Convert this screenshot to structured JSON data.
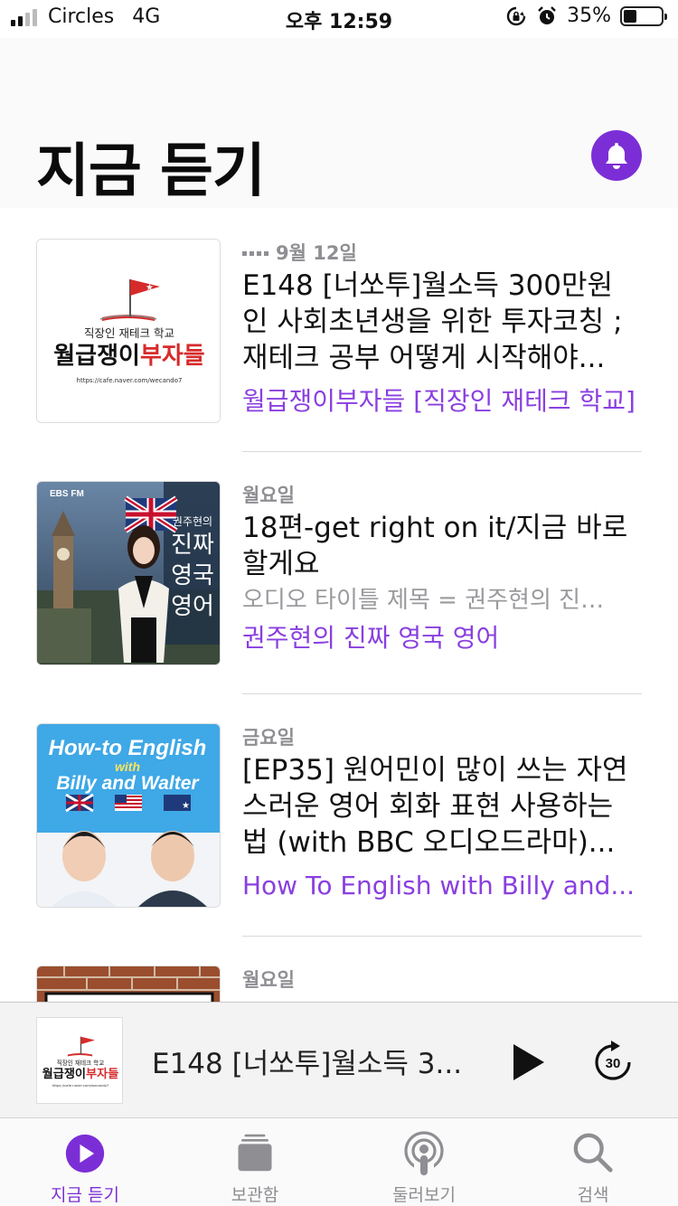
{
  "status_bar": {
    "carrier": "Circles",
    "network": "4G",
    "time": "오후 12:59",
    "battery": "35%"
  },
  "header": {
    "title": "지금 듣기"
  },
  "episodes": [
    {
      "date": "9월 12일",
      "title": "E148 [너쏘투]월소득 300만원 인 사회초년생을 위한 투자코칭 ; 재테크 공부 어떻게 시작해야...",
      "description": "",
      "show": "월급쟁이부자들 [직장인 재테크 학교]",
      "art": {
        "subtitle": "직장인 재테크 학교",
        "name_black": "월급쟁이",
        "name_red": "부자들",
        "url": "https://cafe.naver.com/wecando7"
      }
    },
    {
      "date": "월요일",
      "title": "18편-get right on it/지금 바로 할게요",
      "description": "오디오 타이틀 제목 = 권주현의 진…",
      "show": "권주현의 진짜 영국 영어",
      "art": {
        "brand": "EBS FM",
        "name_small": "권주현의",
        "name_lines": [
          "진짜",
          "영국",
          "영어"
        ]
      }
    },
    {
      "date": "금요일",
      "title": "[EP35] 원어민이 많이 쓰는 자연스러운 영어 회화 표현 사용하는 법 (with BBC 오디오드라마)...",
      "description": "",
      "show": "How To English with Billy and...",
      "art": {
        "line1": "How-to English",
        "line2": "with",
        "line3": "Billy and Walter"
      }
    },
    {
      "date": "월요일",
      "title": "",
      "description": "",
      "show": ""
    }
  ],
  "mini_player": {
    "title": "E148 [너쏘투]월소득 3...",
    "skip_seconds": "30",
    "art": {
      "subtitle": "직장인 재테크 학교",
      "name_black": "월급쟁이",
      "name_red": "부자들",
      "url": "https://cafe.naver.com/wecando7"
    }
  },
  "tabs": [
    {
      "label": "지금 듣기",
      "icon": "play-circle-icon",
      "active": true
    },
    {
      "label": "보관함",
      "icon": "library-stack-icon",
      "active": false
    },
    {
      "label": "둘러보기",
      "icon": "podcast-icon",
      "active": false
    },
    {
      "label": "검색",
      "icon": "search-icon",
      "active": false
    }
  ],
  "colors": {
    "accent": "#7c2ed6",
    "show_link": "#8a3fe0",
    "secondary_text": "#8e8e93",
    "logo_red": "#d62b2b"
  }
}
